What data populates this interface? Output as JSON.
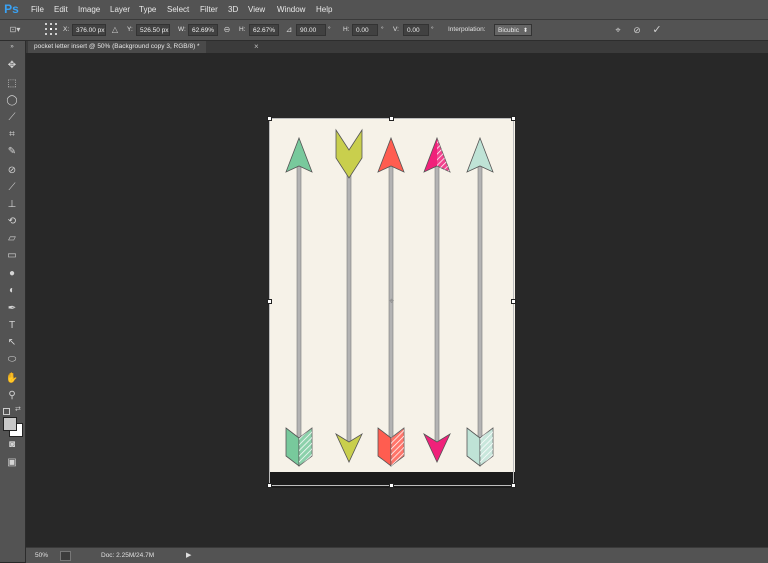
{
  "app": {
    "logo": "Ps"
  },
  "menu": [
    "File",
    "Edit",
    "Image",
    "Layer",
    "Type",
    "Select",
    "Filter",
    "3D",
    "View",
    "Window",
    "Help"
  ],
  "options": {
    "x_label": "X:",
    "x_value": "376.00 px",
    "y_label": "Y:",
    "y_value": "526.50 px",
    "w_label": "W:",
    "w_value": "62.69%",
    "h_label": "H:",
    "h_value": "62.67%",
    "angle_value": "90.00",
    "angle_unit": "°",
    "hskew_label": "H:",
    "hskew_value": "0.00",
    "hskew_unit": "°",
    "vskew_label": "V:",
    "vskew_value": "0.00",
    "vskew_unit": "°",
    "interp_label": "Interpolation:",
    "interp_value": "Bicubic"
  },
  "document": {
    "tab_title": "pocket letter insert @ 50% (Background copy 3, RGB/8) *"
  },
  "status": {
    "zoom": "50%",
    "doc_info": "Doc: 2.25M/24.7M"
  },
  "artwork": {
    "background": "#f6f2e8",
    "arrow_colors": [
      "#78c99c",
      "#c9cf4d",
      "#ff5d50",
      "#f0217a",
      "#bfe3d6"
    ]
  }
}
